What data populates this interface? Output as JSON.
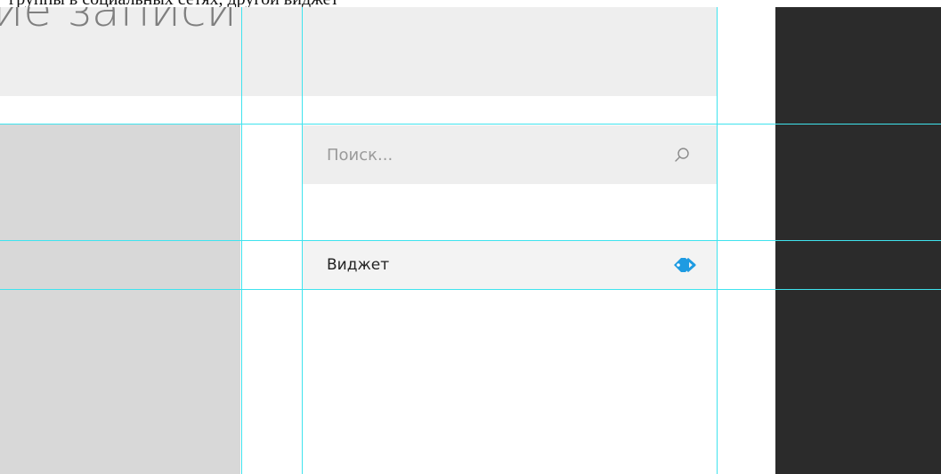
{
  "top_strip": {
    "text": "группы в социальных сетях, другой виджет"
  },
  "page": {
    "heading": "ие записи"
  },
  "search": {
    "placeholder": "Поиск..."
  },
  "widget": {
    "label": "Виджет"
  },
  "icons": {
    "search": "search-icon",
    "widget": "tag-arrow-icon"
  },
  "colors": {
    "accent": "#1e9be2",
    "guide": "#3fe3ee",
    "dark_column": "#2b2b2b",
    "left_panel": "#d8d8d8",
    "band": "#eeeeee"
  }
}
